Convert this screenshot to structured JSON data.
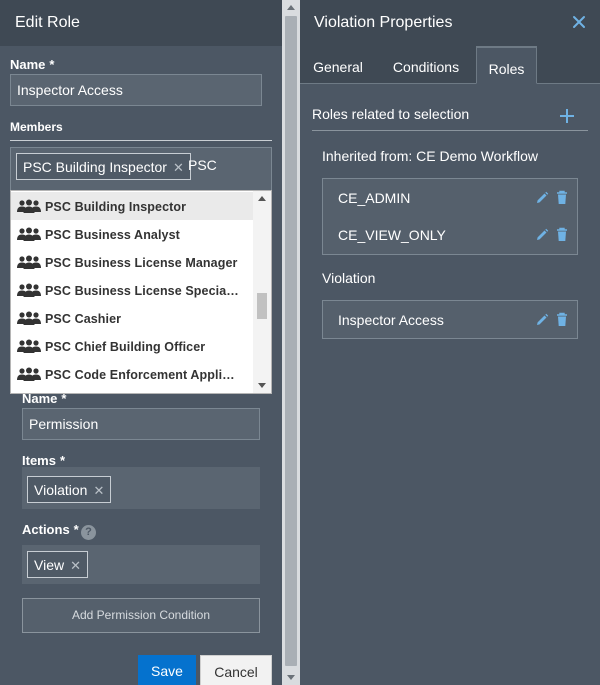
{
  "edit_role": {
    "title": "Edit Role",
    "name_label": "Name",
    "required_mark": "*",
    "name_value": "Inspector Access",
    "members_label": "Members",
    "member_chip": "PSC Building Inspector",
    "chip_remove": "✕",
    "members_query": "PSC",
    "dropdown_options": [
      "PSC Building Inspector",
      "PSC Business Analyst",
      "PSC Business License Manager",
      "PSC Business License Specia…",
      "PSC Cashier",
      "PSC Chief Building Officer",
      "PSC Code Enforcement Appli…"
    ],
    "permission": {
      "name_label": "Name",
      "name_value": "Permission",
      "items_label": "Items",
      "item_chip": "Violation",
      "actions_label": "Actions",
      "help": "?",
      "action_chip": "View",
      "add_condition": "Add Permission Condition"
    },
    "save": "Save",
    "cancel": "Cancel"
  },
  "violation_properties": {
    "title": "Violation Properties",
    "tabs": [
      "General",
      "Conditions",
      "Roles"
    ],
    "active_tab": "Roles",
    "section_title": "Roles related to selection",
    "inherited_title": "Inherited from: CE Demo Workflow",
    "inherited_roles": [
      "CE_ADMIN",
      "CE_VIEW_ONLY"
    ],
    "violation_title": "Violation",
    "violation_roles": [
      "Inspector Access"
    ]
  },
  "colors": {
    "panel_bg": "#4c5764",
    "header_bg": "#3f4954",
    "save_button": "#0572ce",
    "accent_icon": "#6fb2e4"
  }
}
